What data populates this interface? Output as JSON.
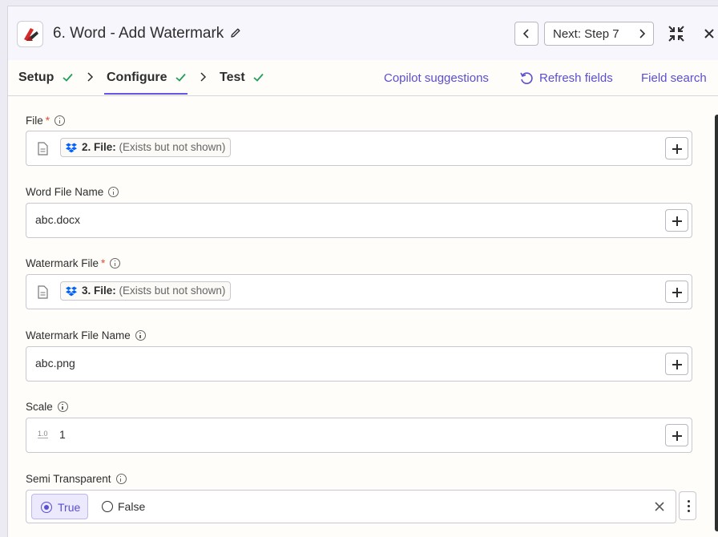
{
  "header": {
    "title": "6. Word - Add Watermark",
    "next_label": "Next: Step 7",
    "icons": {
      "app": "word-watermark-app-icon",
      "edit": "pencil-icon",
      "prev": "chevron-left-icon",
      "next": "chevron-right-icon",
      "collapse": "collapse-icon",
      "close": "close-icon"
    }
  },
  "tabs": [
    {
      "label": "Setup",
      "status": "complete"
    },
    {
      "label": "Configure",
      "status": "complete",
      "active": true
    },
    {
      "label": "Test",
      "status": "complete"
    }
  ],
  "toolbar": {
    "copilot": "Copilot suggestions",
    "refresh": "Refresh fields",
    "search": "Field search"
  },
  "fields": {
    "file": {
      "label": "File",
      "required": "*",
      "pill_name": "2. File:",
      "pill_value": "(Exists but not shown)"
    },
    "word_file_name": {
      "label": "Word File Name",
      "value": "abc.docx"
    },
    "watermark_file": {
      "label": "Watermark File",
      "required": "*",
      "pill_name": "3. File:",
      "pill_value": "(Exists but not shown)"
    },
    "watermark_file_name": {
      "label": "Watermark File Name",
      "value": "abc.png"
    },
    "scale": {
      "label": "Scale",
      "value": "1",
      "type_icon": "1.0"
    },
    "semi_transparent": {
      "label": "Semi Transparent",
      "options": [
        "True",
        "False"
      ],
      "selected": "True"
    }
  },
  "colors": {
    "accent": "#6355e6",
    "link": "#5a4fd0",
    "check": "#1f9e5b",
    "required": "#e8492c",
    "dropbox": "#0061fe"
  }
}
